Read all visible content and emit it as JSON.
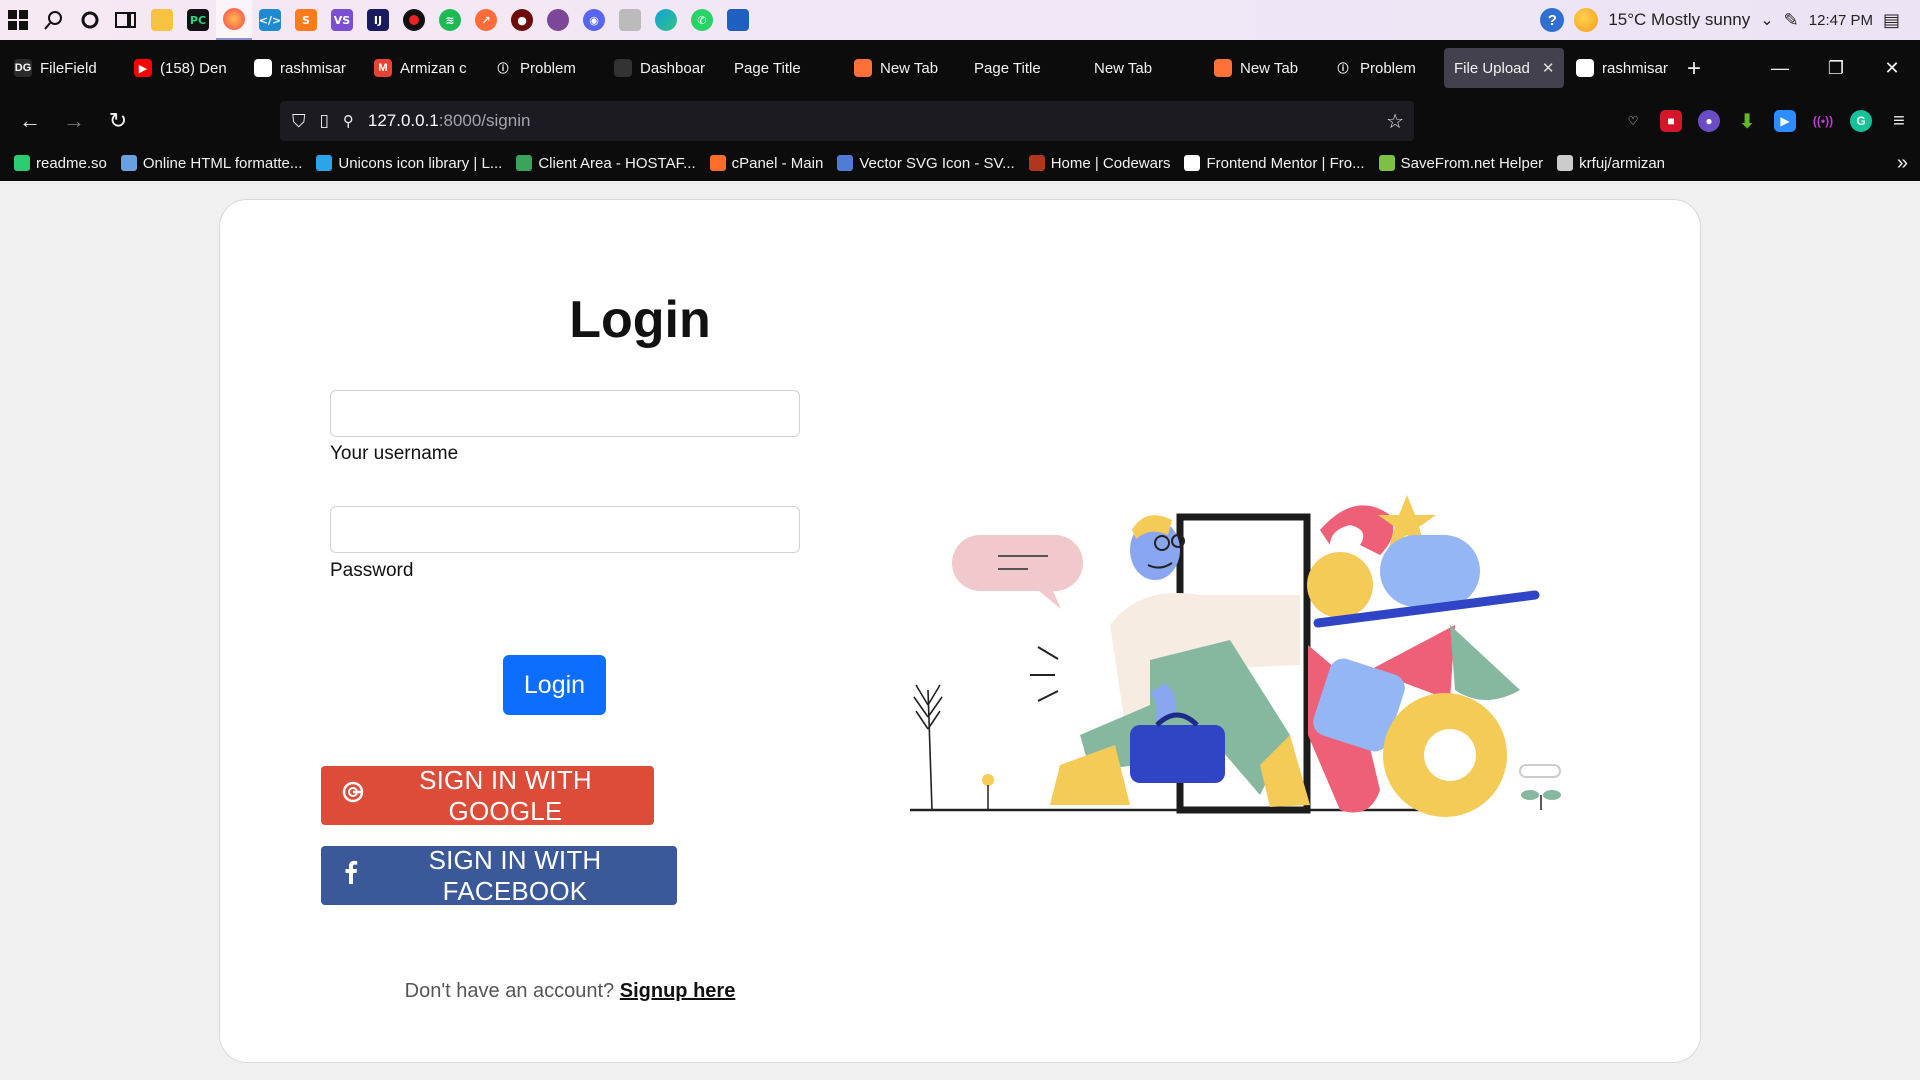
{
  "taskbar": {
    "weather": "15°C  Mostly sunny",
    "time": "12:47 PM"
  },
  "tabs": [
    {
      "label": "FileField",
      "fav_color": "#2b2b2b",
      "fav_text": "DG"
    },
    {
      "label": "(158) Den",
      "fav_color": "#ff0000",
      "fav_text": "▶"
    },
    {
      "label": "rashmisar",
      "fav_color": "#ffffff",
      "fav_text": ""
    },
    {
      "label": "Armizan c",
      "fav_color": "#ea4335",
      "fav_text": "M"
    },
    {
      "label": "Problem",
      "fav_color": "#0c0c0d",
      "fav_text": "ⓘ"
    },
    {
      "label": "Dashboar",
      "fav_color": "#333333",
      "fav_text": ""
    },
    {
      "label": "Page Title",
      "fav_color": "",
      "fav_text": ""
    },
    {
      "label": "New Tab",
      "fav_color": "#ff7139",
      "fav_text": ""
    },
    {
      "label": "Page Title",
      "fav_color": "",
      "fav_text": ""
    },
    {
      "label": "New Tab",
      "fav_color": "",
      "fav_text": ""
    },
    {
      "label": "New Tab",
      "fav_color": "#ff7139",
      "fav_text": ""
    },
    {
      "label": "Problem",
      "fav_color": "#0c0c0d",
      "fav_text": "ⓘ"
    },
    {
      "label": "File Upload",
      "fav_color": "",
      "fav_text": ""
    },
    {
      "label": "rashmisar",
      "fav_color": "#ffffff",
      "fav_text": ""
    }
  ],
  "active_tab_index": 12,
  "url": {
    "host": "127.0.0.1",
    "path": ":8000/signin"
  },
  "bookmarks": [
    {
      "label": "readme.so",
      "color": "#2ecc71"
    },
    {
      "label": "Online HTML formatte...",
      "color": "#6aa0e0"
    },
    {
      "label": "Unicons icon library | L...",
      "color": "#2aa6e8"
    },
    {
      "label": "Client Area - HOSTAF...",
      "color": "#3aa55a"
    },
    {
      "label": "cPanel - Main",
      "color": "#ff6c2c"
    },
    {
      "label": "Vector SVG Icon - SV...",
      "color": "#4f7ad6"
    },
    {
      "label": "Home | Codewars",
      "color": "#b1361e"
    },
    {
      "label": "Frontend Mentor | Fro...",
      "color": "#ffffff"
    },
    {
      "label": "SaveFrom.net Helper",
      "color": "#7cc142"
    },
    {
      "label": "krfuj/armizan",
      "color": "#cccccc"
    }
  ],
  "login": {
    "title": "Login",
    "username_label": "Your username",
    "password_label": "Password",
    "username_value": "",
    "password_value": "",
    "submit_label": "Login",
    "google_label": "SIGN IN WITH GOOGLE",
    "facebook_label": "SIGN IN WITH FACEBOOK",
    "signup_prompt": "Don't have an account?",
    "signup_link": "Signup here"
  },
  "colors": {
    "primary": "#0d6efd",
    "google": "#dd4b39",
    "facebook": "#3b5998"
  }
}
